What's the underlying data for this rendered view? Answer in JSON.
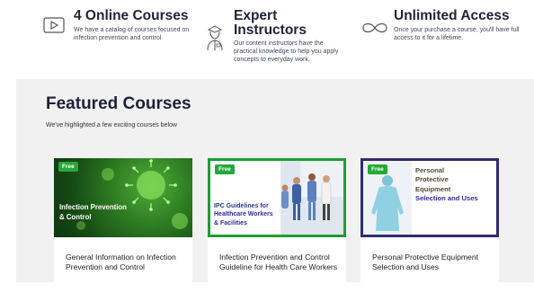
{
  "features": [
    {
      "icon": "play-video-icon",
      "title": "4 Online Courses",
      "description": "We have a catalog of courses focused on infection prevention and control"
    },
    {
      "icon": "instructor-icon",
      "title": "Expert Instructors",
      "description": "Our content instructors have the practical knowledge to help you apply concepts to everyday work."
    },
    {
      "icon": "infinity-icon",
      "title": "Unlimited Access",
      "description": "Once your purchase a course, you'll have full access to it for a lifetime."
    }
  ],
  "featured": {
    "heading": "Featured Courses",
    "subheading": "We've highlighted a few exciting courses below"
  },
  "courses": [
    {
      "badge": "Free",
      "thumb_line1": "Infection Prevention",
      "thumb_line2": "& Control",
      "title": "General Information on Infection Prevention and Control"
    },
    {
      "badge": "Free",
      "thumb_line1": "IPC Guidelines for",
      "thumb_line2": "Healthcare Workers",
      "thumb_line3": "& Facilities",
      "title": "Infection Prevention and Control Guideline for Health Care Workers"
    },
    {
      "badge": "Free",
      "thumb_line1": "Personal",
      "thumb_line2": "Protective",
      "thumb_line3": "Equipment",
      "thumb_line4": "Selection and Uses",
      "title": "Personal Protective Equipment Selection and Uses"
    }
  ],
  "colors": {
    "badge": "#26a83a",
    "card2_border": "#1f9c33",
    "card3_border": "#2f2d6e",
    "section_bg": "#f1f1f1",
    "heading": "#1f1f38"
  }
}
